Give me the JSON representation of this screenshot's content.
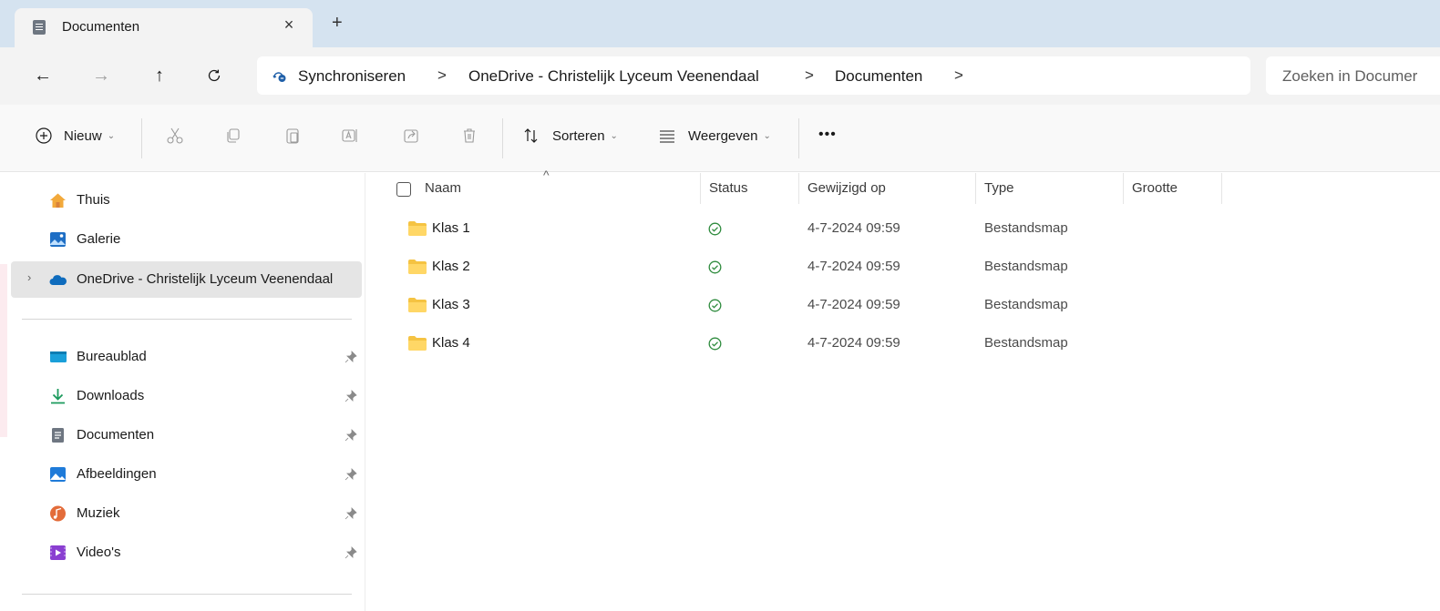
{
  "tab": {
    "title": "Documenten",
    "close": "×",
    "new": "+"
  },
  "nav": {
    "back": "←",
    "forward": "→",
    "up": "↑",
    "refresh": "C",
    "breadcrumb": [
      "Synchroniseren",
      "OneDrive - Christelijk Lyceum Veenendaal",
      "Documenten"
    ],
    "separator": ">",
    "search_placeholder": "Zoeken in Documer"
  },
  "toolbar": {
    "new_label": "Nieuw",
    "sort_label": "Sorteren",
    "view_label": "Weergeven",
    "more_label": "•••"
  },
  "sidebar": {
    "top_items": [
      {
        "label": "Thuis",
        "icon": "home-icon"
      },
      {
        "label": "Galerie",
        "icon": "gallery-icon"
      },
      {
        "label": "OneDrive - Christelijk Lyceum Veenendaal",
        "icon": "onedrive-icon",
        "selected": true
      }
    ],
    "pinned_items": [
      {
        "label": "Bureaublad",
        "icon": "desktop-icon"
      },
      {
        "label": "Downloads",
        "icon": "downloads-icon"
      },
      {
        "label": "Documenten",
        "icon": "documents-icon"
      },
      {
        "label": "Afbeeldingen",
        "icon": "pictures-icon"
      },
      {
        "label": "Muziek",
        "icon": "music-icon"
      },
      {
        "label": "Video's",
        "icon": "videos-icon"
      }
    ]
  },
  "columns": {
    "name": "Naam",
    "status": "Status",
    "modified": "Gewijzigd op",
    "type": "Type",
    "size": "Grootte"
  },
  "files": [
    {
      "name": "Klas 1",
      "modified": "4-7-2024 09:59",
      "type": "Bestandsmap",
      "status": "synced"
    },
    {
      "name": "Klas 2",
      "modified": "4-7-2024 09:59",
      "type": "Bestandsmap",
      "status": "synced"
    },
    {
      "name": "Klas 3",
      "modified": "4-7-2024 09:59",
      "type": "Bestandsmap",
      "status": "synced"
    },
    {
      "name": "Klas 4",
      "modified": "4-7-2024 09:59",
      "type": "Bestandsmap",
      "status": "synced"
    }
  ],
  "colors": {
    "accent": "#0067c0",
    "folder": "#f5c342",
    "status_green": "#2e8b3d",
    "titlebar": "#d5e3f0"
  }
}
